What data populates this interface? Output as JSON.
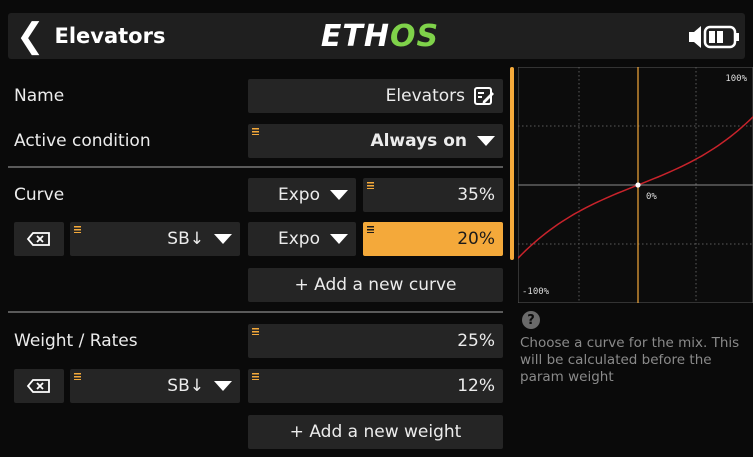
{
  "header": {
    "back_icon": "〈",
    "title": "Elevators",
    "logo_main": "ETH",
    "logo_accent": "OS",
    "battery_icon": "battery-speaker-icon"
  },
  "rows": {
    "name": {
      "label": "Name",
      "value": "Elevators"
    },
    "active_condition": {
      "label": "Active condition",
      "value": "Always on"
    },
    "curve": {
      "label": "Curve",
      "type": "Expo",
      "value": "35%"
    },
    "curve_alt": {
      "switch": "SB↓",
      "type": "Expo",
      "value": "20%"
    },
    "add_curve": "+ Add a new curve",
    "weight": {
      "label": "Weight / Rates",
      "value": "25%"
    },
    "weight_alt": {
      "switch": "SB↓",
      "value": "12%"
    },
    "add_weight": "+ Add a new weight"
  },
  "graph": {
    "label_top": "100%",
    "label_center": "0%",
    "label_bottom": "-100%"
  },
  "help": {
    "icon": "?",
    "text": "Choose a curve for the mix. This will be calculated before the param weight"
  },
  "colors": {
    "accent": "#f4a93a",
    "curve": "#c8232b",
    "logo_accent": "#7fd24a"
  }
}
